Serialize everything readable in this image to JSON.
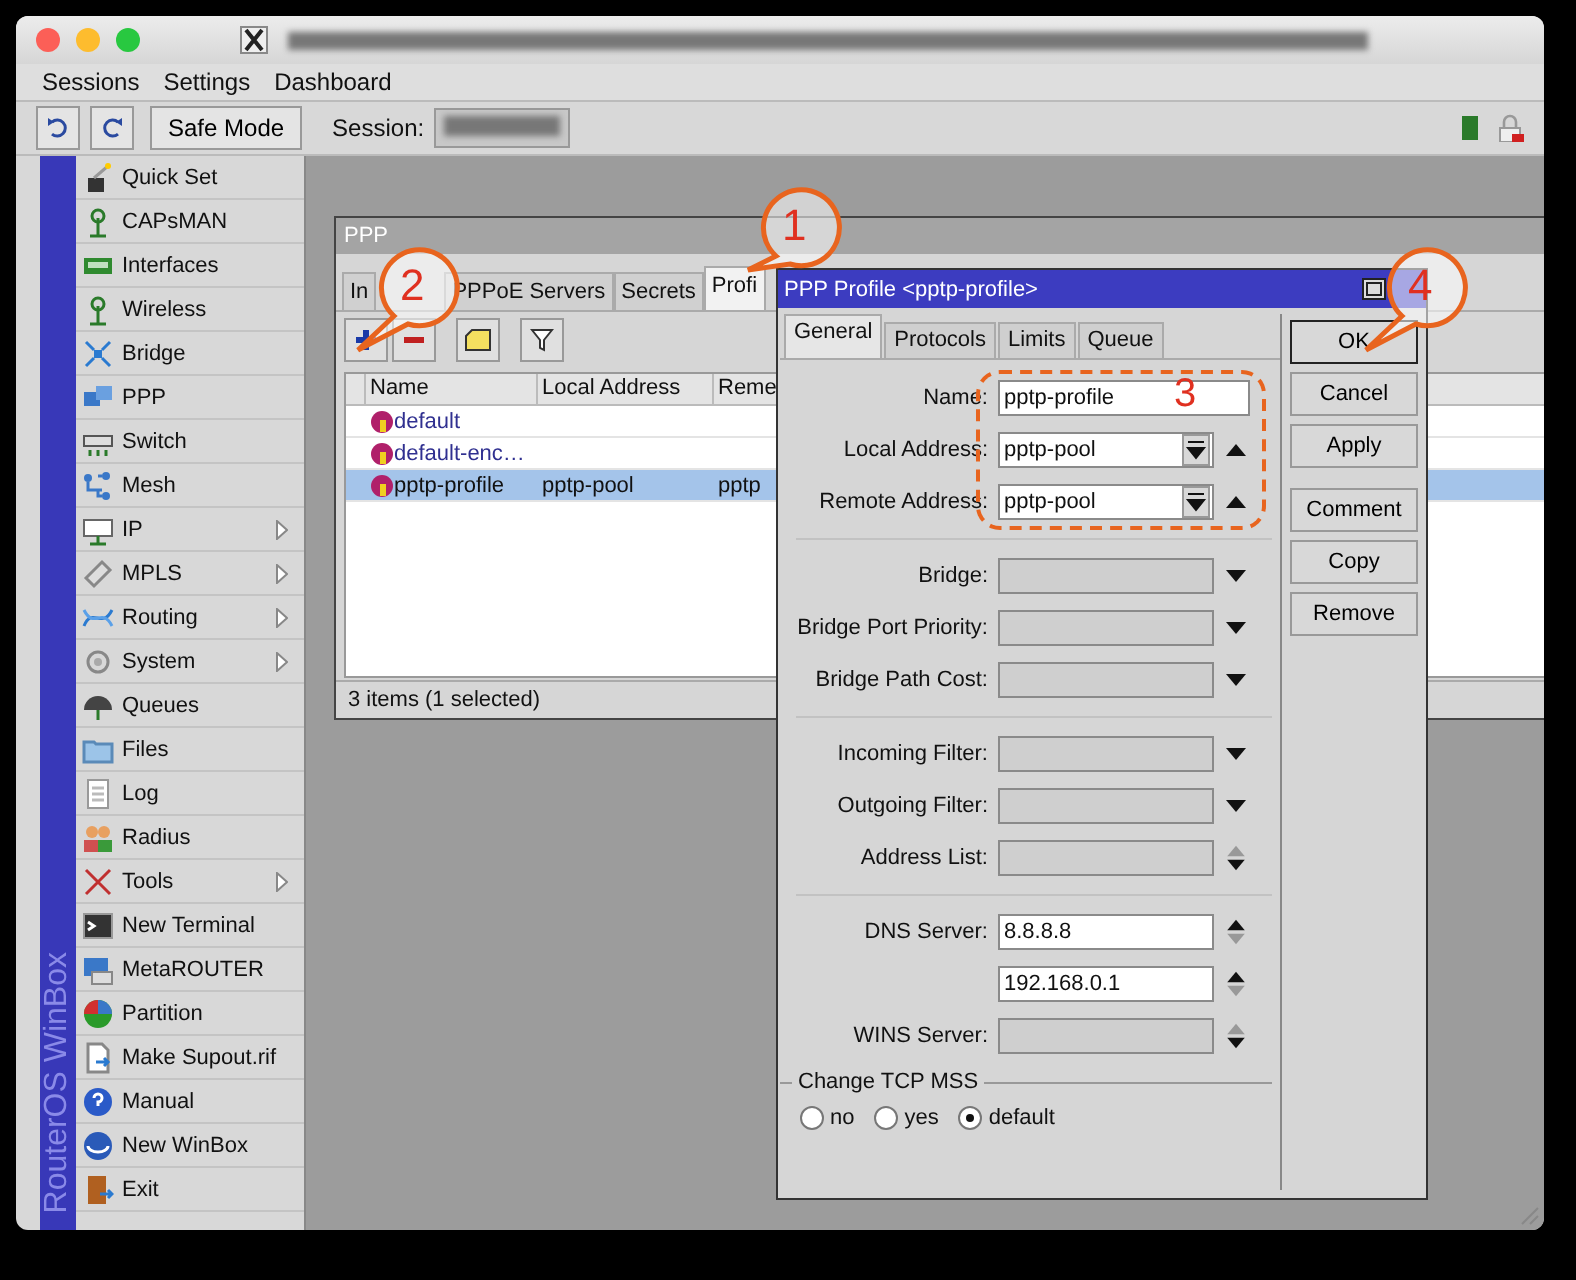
{
  "menu": [
    "Sessions",
    "Settings",
    "Dashboard"
  ],
  "toolbar": {
    "safe_mode": "Safe Mode",
    "session_label": "Session:"
  },
  "sidebar": {
    "brand": "RouterOS WinBox",
    "items": [
      {
        "label": "Quick Set",
        "submenu": false
      },
      {
        "label": "CAPsMAN",
        "submenu": false
      },
      {
        "label": "Interfaces",
        "submenu": false
      },
      {
        "label": "Wireless",
        "submenu": false
      },
      {
        "label": "Bridge",
        "submenu": false
      },
      {
        "label": "PPP",
        "submenu": false
      },
      {
        "label": "Switch",
        "submenu": false
      },
      {
        "label": "Mesh",
        "submenu": false
      },
      {
        "label": "IP",
        "submenu": true
      },
      {
        "label": "MPLS",
        "submenu": true
      },
      {
        "label": "Routing",
        "submenu": true
      },
      {
        "label": "System",
        "submenu": true
      },
      {
        "label": "Queues",
        "submenu": false
      },
      {
        "label": "Files",
        "submenu": false
      },
      {
        "label": "Log",
        "submenu": false
      },
      {
        "label": "Radius",
        "submenu": false
      },
      {
        "label": "Tools",
        "submenu": true
      },
      {
        "label": "New Terminal",
        "submenu": false
      },
      {
        "label": "MetaROUTER",
        "submenu": false
      },
      {
        "label": "Partition",
        "submenu": false
      },
      {
        "label": "Make Supout.rif",
        "submenu": false
      },
      {
        "label": "Manual",
        "submenu": false
      },
      {
        "label": "New WinBox",
        "submenu": false
      },
      {
        "label": "Exit",
        "submenu": false
      }
    ]
  },
  "ppp_window": {
    "title": "PPP",
    "tabs": [
      {
        "label": "In",
        "selected": false
      },
      {
        "label": "PPPoE Servers",
        "selected": false
      },
      {
        "label": "Secrets",
        "selected": false
      },
      {
        "label": "Profi",
        "selected": true
      }
    ],
    "columns": [
      "Name",
      "Local Address",
      "Reme"
    ],
    "rows": [
      {
        "name": "default",
        "builtin": true,
        "selected": false
      },
      {
        "name": "default-enc…",
        "builtin": true,
        "selected": false
      },
      {
        "name": "pptp-profile",
        "local_address": "pptp-pool",
        "column_3": "pptp",
        "builtin": false,
        "selected": true
      }
    ],
    "status": "3 items (1 selected)"
  },
  "profile_dialog": {
    "title": "PPP Profile <pptp-profile>",
    "tabs": [
      {
        "label": "General",
        "selected": true
      },
      {
        "label": "Protocols",
        "selected": false
      },
      {
        "label": "Limits",
        "selected": false
      },
      {
        "label": "Queue",
        "selected": false
      }
    ],
    "fields": [
      {
        "kind": "text",
        "label": "Name:",
        "value": "pptp-profile"
      },
      {
        "kind": "combo",
        "label": "Local Address:",
        "value": "pptp-pool"
      },
      {
        "kind": "combo",
        "label": "Remote Address:",
        "value": "pptp-pool"
      },
      {
        "kind": "separator"
      },
      {
        "kind": "select",
        "label": "Bridge:"
      },
      {
        "kind": "select",
        "label": "Bridge Port Priority:"
      },
      {
        "kind": "select",
        "label": "Bridge Path Cost:"
      },
      {
        "kind": "separator"
      },
      {
        "kind": "select",
        "label": "Incoming Filter:"
      },
      {
        "kind": "select",
        "label": "Outgoing Filter:"
      },
      {
        "kind": "list",
        "label": "Address List:"
      },
      {
        "kind": "separator"
      },
      {
        "kind": "list",
        "label": "DNS Server:",
        "value": "8.8.8.8"
      },
      {
        "kind": "list",
        "value": "192.168.0.1"
      },
      {
        "kind": "list",
        "label": "WINS Server:"
      }
    ],
    "tcp_mss": {
      "title": "Change TCP MSS",
      "options": [
        {
          "label": "no",
          "selected": false
        },
        {
          "label": "yes",
          "selected": false
        },
        {
          "label": "default",
          "selected": true
        }
      ]
    },
    "buttons": [
      {
        "label": "OK",
        "default": true
      },
      {
        "label": "Cancel",
        "default": false
      },
      {
        "label": "Apply",
        "default": false
      },
      {
        "label": "Comment",
        "default": false
      },
      {
        "label": "Copy",
        "default": false
      },
      {
        "label": "Remove",
        "default": false
      }
    ]
  },
  "annotations": [
    {
      "kind": "bubble",
      "number": "1"
    },
    {
      "kind": "bubble",
      "number": "2"
    },
    {
      "kind": "frame",
      "number": "3"
    },
    {
      "kind": "bubble",
      "number": "4"
    }
  ]
}
